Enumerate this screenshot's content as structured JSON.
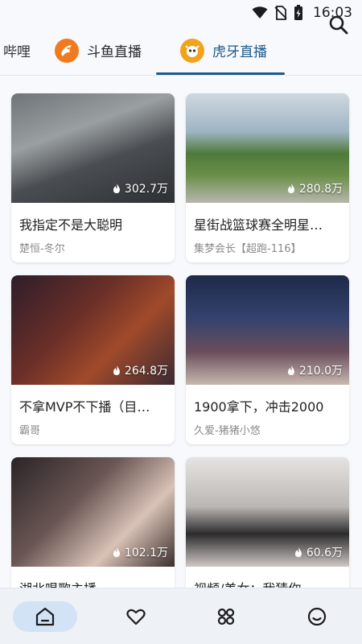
{
  "status": {
    "time": "16:03"
  },
  "tabs": [
    {
      "label": "哔哩",
      "state": "partial"
    },
    {
      "label": "斗鱼直播",
      "state": "normal",
      "logo_color": "#f07b1e"
    },
    {
      "label": "虎牙直播",
      "state": "active",
      "logo_color": "#f2a31b"
    }
  ],
  "accent_color": "#1f5a8c",
  "streams": [
    {
      "title": "我指定不是大聪明",
      "anchor": "楚恒-冬尔",
      "viewers": "302.7万"
    },
    {
      "title": "星街战篮球赛全明星…",
      "anchor": "集梦会长【超跑-116】",
      "viewers": "280.8万"
    },
    {
      "title": "不拿MVP不下播（目…",
      "anchor": "霸哥",
      "viewers": "264.8万"
    },
    {
      "title": "1900拿下，冲击2000",
      "anchor": "久爱-猪猪小悠",
      "viewers": "210.0万"
    },
    {
      "title": "湖北唱歌主播~",
      "anchor": "",
      "viewers": "102.1万"
    },
    {
      "title": "视频/美女：我猜你…",
      "anchor": "",
      "viewers": "60.6万"
    }
  ],
  "bottom_nav": [
    {
      "icon": "home-icon",
      "active": true
    },
    {
      "icon": "heart-icon",
      "active": false
    },
    {
      "icon": "categories-icon",
      "active": false
    },
    {
      "icon": "smiley-icon",
      "active": false
    }
  ]
}
